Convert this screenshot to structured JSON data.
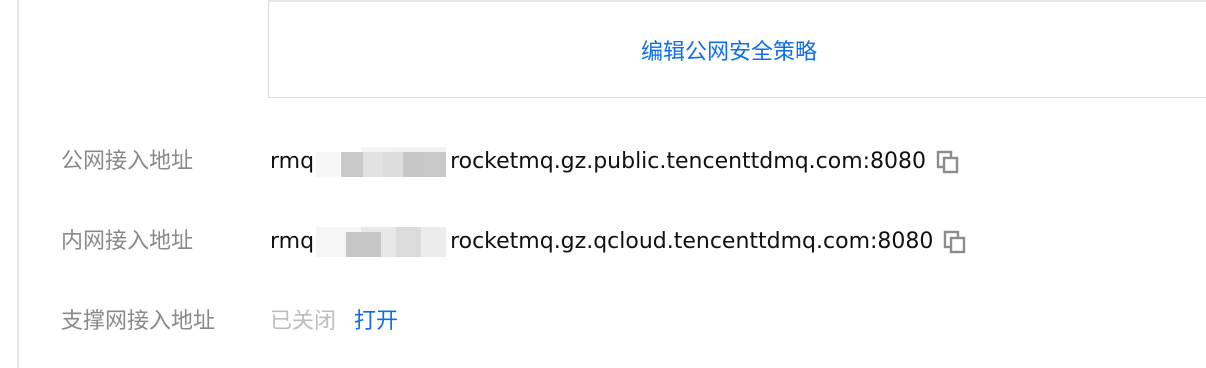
{
  "policy": {
    "edit_label": "编辑公网安全策略"
  },
  "fields": {
    "public": {
      "label": "公网接入地址",
      "prefix": "rmq",
      "suffix": "rocketmq.gz.public.tencenttdmq.com:8080"
    },
    "intranet": {
      "label": "内网接入地址",
      "prefix": "rmq",
      "suffix": "rocketmq.gz.qcloud.tencenttdmq.com:8080"
    },
    "support": {
      "label": "支撑网接入地址",
      "status": "已关闭",
      "action": "打开"
    }
  },
  "colors": {
    "link": "#0f6fe8",
    "label": "#8a8a8a",
    "value": "#111111",
    "disabled": "#bdbdbd"
  }
}
